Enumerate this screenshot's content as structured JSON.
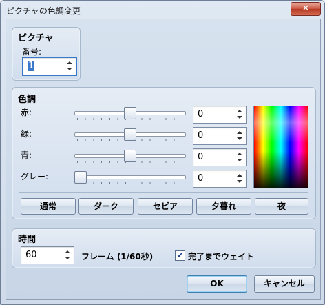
{
  "window": {
    "title": "ピクチャの色調変更",
    "close_glyph": "✕"
  },
  "picture": {
    "title": "ピクチャ",
    "number_label": "番号:",
    "number_value": "1"
  },
  "color": {
    "title": "色調",
    "rows": [
      {
        "label": "赤:",
        "value": "0",
        "slider_fraction": 0.5
      },
      {
        "label": "緑:",
        "value": "0",
        "slider_fraction": 0.5
      },
      {
        "label": "青:",
        "value": "0",
        "slider_fraction": 0.5
      },
      {
        "label": "グレー:",
        "value": "0",
        "slider_fraction": 0.0
      }
    ],
    "presets": [
      "通常",
      "ダーク",
      "セピア",
      "夕暮れ",
      "夜"
    ]
  },
  "time": {
    "title": "時間",
    "value": "60",
    "frames_label": "フレーム (1/60秒)",
    "wait_label": "完了までウェイト",
    "wait_checked": true
  },
  "buttons": {
    "ok": "OK",
    "cancel": "キャンセル"
  }
}
